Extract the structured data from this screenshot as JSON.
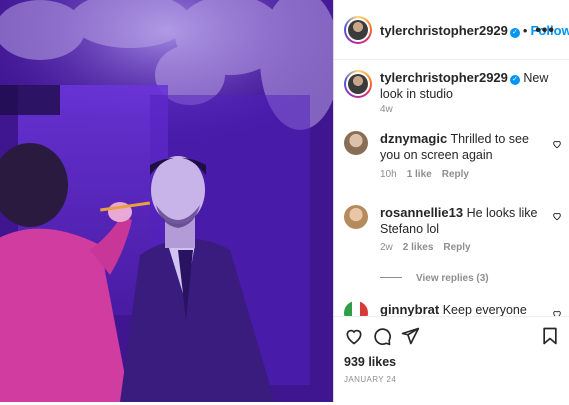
{
  "post": {
    "author": "tylerchristopher2929",
    "follow_label": "Follow",
    "separator": "•",
    "more_label": "•••",
    "caption": "New look in studio",
    "caption_age": "4w",
    "verified_mark": "✓"
  },
  "comments": [
    {
      "user": "dznymagic",
      "text": "Thrilled to see you on screen again",
      "time": "10h",
      "likes": "1 like",
      "reply": "Reply"
    },
    {
      "user": "rosannellie13",
      "text": "He looks like Stefano lol",
      "time": "2w",
      "likes": "2 likes",
      "reply": "Reply"
    },
    {
      "user": "ginnybrat",
      "text": "Keep everyone"
    }
  ],
  "view_replies": "View replies (3)",
  "likes_count": "939 likes",
  "post_date": "JANUARY 24",
  "colors": {
    "accent": "#0095f6",
    "text": "#262626",
    "muted": "#8e8e8e",
    "photo_purple": "#5a22c8"
  }
}
